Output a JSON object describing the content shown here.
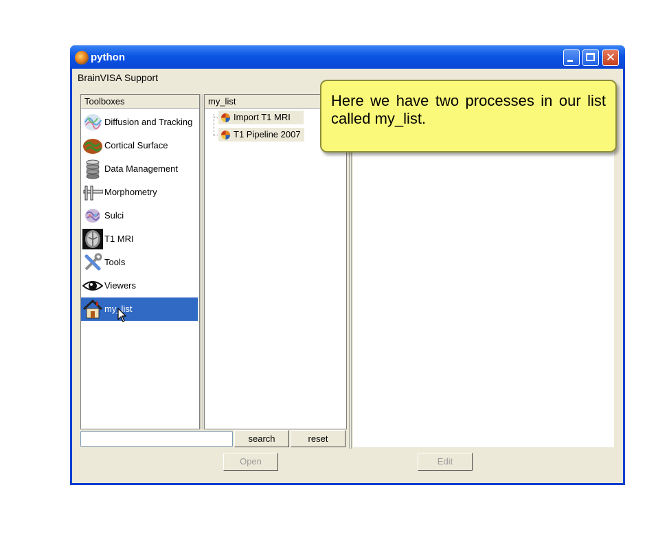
{
  "window": {
    "title": "python"
  },
  "menubar": [
    "BrainVISA",
    "Support"
  ],
  "toolboxes": {
    "header": "Toolboxes",
    "items": [
      {
        "label": "Diffusion and Tracking",
        "icon": "diffusion-tracking-icon",
        "selected": false
      },
      {
        "label": "Cortical Surface",
        "icon": "cortical-surface-icon",
        "selected": false
      },
      {
        "label": "Data Management",
        "icon": "database-icon",
        "selected": false
      },
      {
        "label": "Morphometry",
        "icon": "caliper-icon",
        "selected": false
      },
      {
        "label": "Sulci",
        "icon": "sulci-brain-icon",
        "selected": false
      },
      {
        "label": "T1 MRI",
        "icon": "t1-mri-icon",
        "selected": false
      },
      {
        "label": "Tools",
        "icon": "tools-icon",
        "selected": false
      },
      {
        "label": "Viewers",
        "icon": "eye-icon",
        "selected": false
      },
      {
        "label": "my_list",
        "icon": "home-icon",
        "selected": true
      }
    ]
  },
  "processes": {
    "header": "my_list",
    "items": [
      {
        "label": "Import T1 MRI",
        "icon": "brainvisa-process-icon"
      },
      {
        "label": "T1 Pipeline 2007",
        "icon": "brainvisa-process-icon"
      }
    ]
  },
  "search": {
    "value": "",
    "search_label": "search",
    "reset_label": "reset"
  },
  "buttons": {
    "open_label": "Open",
    "edit_label": "Edit"
  },
  "callout": {
    "text": "Here we have two processes in our list called my_list."
  },
  "colors": {
    "selection": "#316ac5",
    "callout_bg": "#fbf97a",
    "titlebar": "#0c55e4"
  }
}
